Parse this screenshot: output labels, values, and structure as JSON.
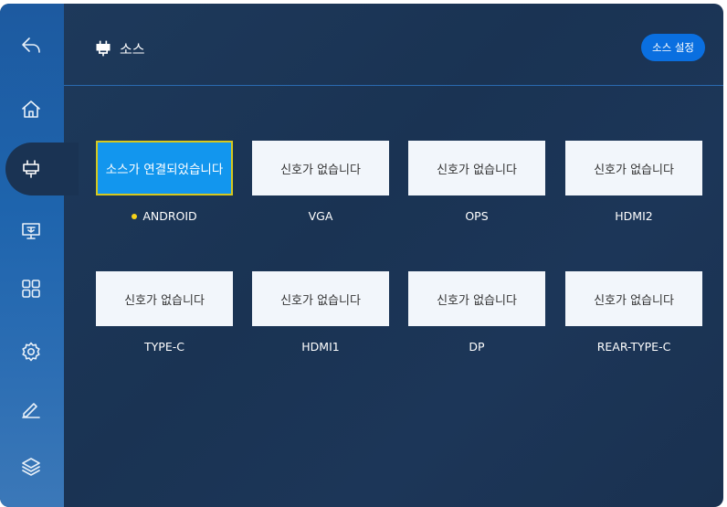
{
  "header": {
    "title": "소스",
    "settings_button": "소스 설정"
  },
  "sidebar": {
    "items": [
      {
        "icon": "back-icon"
      },
      {
        "icon": "home-icon"
      },
      {
        "icon": "source-icon",
        "active": true
      },
      {
        "icon": "screen-icon"
      },
      {
        "icon": "apps-icon"
      },
      {
        "icon": "gear-icon"
      },
      {
        "icon": "pen-icon"
      },
      {
        "icon": "layers-icon"
      }
    ]
  },
  "sources": [
    {
      "status": "소스가 연결되었습니다",
      "name": "ANDROID",
      "selected": true,
      "indicator_color": "#f5d21a"
    },
    {
      "status": "신호가 없습니다",
      "name": "VGA"
    },
    {
      "status": "신호가 없습니다",
      "name": "OPS"
    },
    {
      "status": "신호가 없습니다",
      "name": "HDMI2"
    },
    {
      "status": "신호가 없습니다",
      "name": "TYPE-C"
    },
    {
      "status": "신호가 없습니다",
      "name": "HDMI1"
    },
    {
      "status": "신호가 없습니다",
      "name": "DP"
    },
    {
      "status": "신호가 없습니다",
      "name": "REAR-TYPE-C"
    }
  ],
  "colors": {
    "background": "#1a3353",
    "sidebar": "#1e64ad",
    "accent": "#0a6fe0",
    "selected_tile": "#1296ee",
    "selected_border": "#d6c81e"
  }
}
